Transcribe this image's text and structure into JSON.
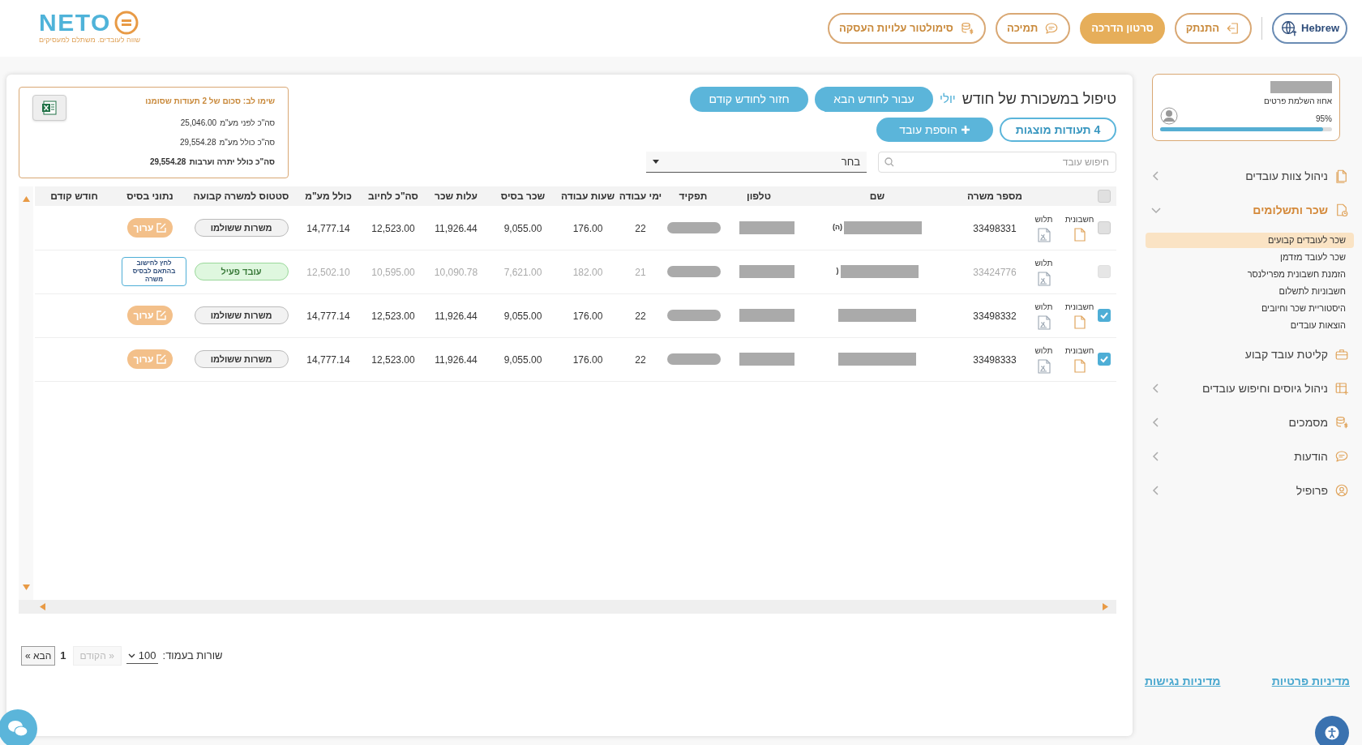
{
  "header": {
    "logo": {
      "wordmark": "NETO",
      "tagline": "שווה לעובדים. משתלם למעסיקים"
    },
    "language": "Hebrew",
    "buttons": [
      {
        "label": "התנתק",
        "kind": "outline"
      },
      {
        "label": "סרטון הדרכה",
        "kind": "filled"
      },
      {
        "label": "תמיכה",
        "kind": "outline"
      },
      {
        "label": "סימולטור עלויות העסקה",
        "kind": "outline"
      }
    ]
  },
  "page": {
    "title": "טיפול במשכורת של חודש",
    "month": "יולי",
    "month_buttons": [
      "עבור לחודש הבא",
      "חזור לחודש קודם"
    ],
    "docs_count": "4 תעודות מוצגות",
    "add_button": "הוספת עובד",
    "search": {
      "placeholder": "חיפוש עובד"
    },
    "filter": {
      "value": "בחר"
    }
  },
  "summary": {
    "title": "שימו לב: סכום של 2 תעודות שסומנו",
    "lines": [
      {
        "label": "סה\"כ לפני מע\"מ",
        "value": "25,046.00",
        "bold": false
      },
      {
        "label": "סה\"כ כולל מע\"מ",
        "value": "29,554.28",
        "bold": false
      },
      {
        "label": "סה\"כ כולל יתרה וערבות",
        "value": "29,554.28",
        "bold": true
      }
    ]
  },
  "table": {
    "select_all": {
      "checked": false
    },
    "columns": [
      "מספר משרה",
      "שם",
      "טלפון",
      "תפקיד",
      "ימי עבודה",
      "שעות עבודה",
      "שכר בסיס",
      "עלות שכר",
      "סה\"כ לחיוב",
      "כולל מע\"מ",
      "סטטוס למשרה קבועה",
      "נתוני בסיס",
      "חודש קודם"
    ],
    "rows": [
      {
        "checked": false,
        "disabled": false,
        "docs": [
          {
            "kind": "invoice",
            "label": "חשבונית"
          },
          {
            "kind": "payslip",
            "label": "תלוש"
          }
        ],
        "job_number": "33498331",
        "name_fragment": "(ה)",
        "days": "22",
        "hours": "176.00",
        "base_salary": "9,055.00",
        "salary_cost": "11,926.44",
        "total_charge": "12,523.00",
        "incl_vat": "14,777.14",
        "status": {
          "kind": "paid",
          "label": "משרות ששולמו"
        },
        "action": {
          "kind": "edit",
          "label": "ערוך"
        }
      },
      {
        "checked": false,
        "disabled": true,
        "docs": [
          {
            "kind": "payslip",
            "label": "תלוש"
          }
        ],
        "job_number": "33424776",
        "name_fragment": "(",
        "days": "21",
        "hours": "182.00",
        "base_salary": "7,621.00",
        "salary_cost": "10,090.78",
        "total_charge": "10,595.00",
        "incl_vat": "12,502.10",
        "status": {
          "kind": "active",
          "label": "עובד פעיל"
        },
        "action": {
          "kind": "note",
          "label": "לחץ לחישוב בהתאם לבסיס משרה"
        }
      },
      {
        "checked": true,
        "disabled": false,
        "docs": [
          {
            "kind": "invoice",
            "label": "חשבונית"
          },
          {
            "kind": "payslip",
            "label": "תלוש"
          }
        ],
        "job_number": "33498332",
        "days": "22",
        "hours": "176.00",
        "base_salary": "9,055.00",
        "salary_cost": "11,926.44",
        "total_charge": "12,523.00",
        "incl_vat": "14,777.14",
        "status": {
          "kind": "paid",
          "label": "משרות ששולמו"
        },
        "action": {
          "kind": "edit",
          "label": "ערוך"
        }
      },
      {
        "checked": true,
        "disabled": false,
        "docs": [
          {
            "kind": "invoice",
            "label": "חשבונית"
          },
          {
            "kind": "payslip",
            "label": "תלוש"
          }
        ],
        "job_number": "33498333",
        "days": "22",
        "hours": "176.00",
        "base_salary": "9,055.00",
        "salary_cost": "11,926.44",
        "total_charge": "12,523.00",
        "incl_vat": "14,777.14",
        "status": {
          "kind": "paid",
          "label": "משרות ששולמו"
        },
        "action": {
          "kind": "edit",
          "label": "ערוך"
        }
      }
    ]
  },
  "pagination": {
    "rows_label": "שורות בעמוד:",
    "page_size": "100",
    "prev": {
      "label": "« הקודם",
      "disabled": true
    },
    "page": "1",
    "next": {
      "label": "הבא »",
      "disabled": false
    }
  },
  "sidebar": {
    "profile": {
      "label": "אחוז השלמת פרטים",
      "percent": "95%",
      "level": 0.95
    },
    "nav": [
      {
        "label": "ניהול צוות עובדים",
        "kind": "group",
        "expanded": false
      },
      {
        "label": "שכר ותשלומים",
        "kind": "group",
        "expanded": true,
        "children": [
          {
            "label": "שכר לעובדים קבועים",
            "selected": true
          },
          {
            "label": "שכר לעובד מזדמן",
            "selected": false
          },
          {
            "label": "הזמנת חשבונית מפרילנסר",
            "selected": false
          },
          {
            "label": "חשבוניות לתשלום",
            "selected": false
          },
          {
            "label": "היסטוריית שכר וחיובים",
            "selected": false
          },
          {
            "label": "הוצאות עובדים",
            "selected": false
          }
        ]
      },
      {
        "label": "קליטת עובד קבוע",
        "kind": "link"
      },
      {
        "label": "ניהול גיוסים וחיפוש עובדים",
        "kind": "group",
        "expanded": false
      },
      {
        "label": "מסמכים",
        "kind": "group",
        "expanded": false
      },
      {
        "label": "הודעות",
        "kind": "group",
        "expanded": false
      },
      {
        "label": "פרופיל",
        "kind": "group",
        "expanded": false
      }
    ],
    "footer_links": [
      "מדיניות פרטיות",
      "מדיניות נגישות"
    ]
  }
}
